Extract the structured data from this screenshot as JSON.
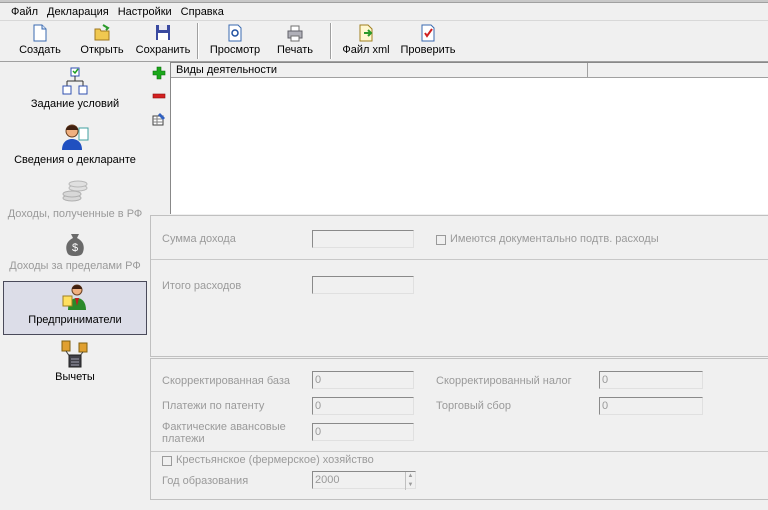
{
  "menu": [
    "Файл",
    "Декларация",
    "Настройки",
    "Справка"
  ],
  "toolbar": {
    "create": "Создать",
    "open": "Открыть",
    "save": "Сохранить",
    "preview": "Просмотр",
    "print": "Печать",
    "xml": "Файл xml",
    "check": "Проверить"
  },
  "sidebar": [
    {
      "label": "Задание условий",
      "icon": "conditions-tree-icon",
      "state": "normal"
    },
    {
      "label": "Сведения о декларанте",
      "icon": "declarant-icon",
      "state": "normal"
    },
    {
      "label": "Доходы, полученные в РФ",
      "icon": "income-rf-icon",
      "state": "disabled"
    },
    {
      "label": "Доходы за пределами РФ",
      "icon": "money-bag-icon",
      "state": "disabled"
    },
    {
      "label": "Предприниматели",
      "icon": "entrepreneur-icon",
      "state": "selected"
    },
    {
      "label": "Вычеты",
      "icon": "deductions-icon",
      "state": "normal"
    }
  ],
  "grid": {
    "column": "Виды деятельности"
  },
  "income": {
    "sum_label": "Сумма дохода",
    "docs_label": "Имеются документально подтв. расходы",
    "total_label": "Итого расходов"
  },
  "adjust": {
    "base_label": "Скорректированная база",
    "base_value": "0",
    "tax_label": "Скорректированный налог",
    "tax_value": "0",
    "patent_label": "Платежи по патенту",
    "patent_value": "0",
    "trade_label": "Торговый сбор",
    "trade_value": "0",
    "advance_label_1": "Фактические авансовые",
    "advance_label_2": "платежи",
    "advance_value": "0",
    "farm_label": "Крестьянское (фермерское) хозяйство",
    "year_label": "Год образования",
    "year_value": "2000"
  },
  "colors": {
    "accent_add": "#1aa81a",
    "accent_remove": "#d42020",
    "selected_bg": "#dcdde8"
  }
}
